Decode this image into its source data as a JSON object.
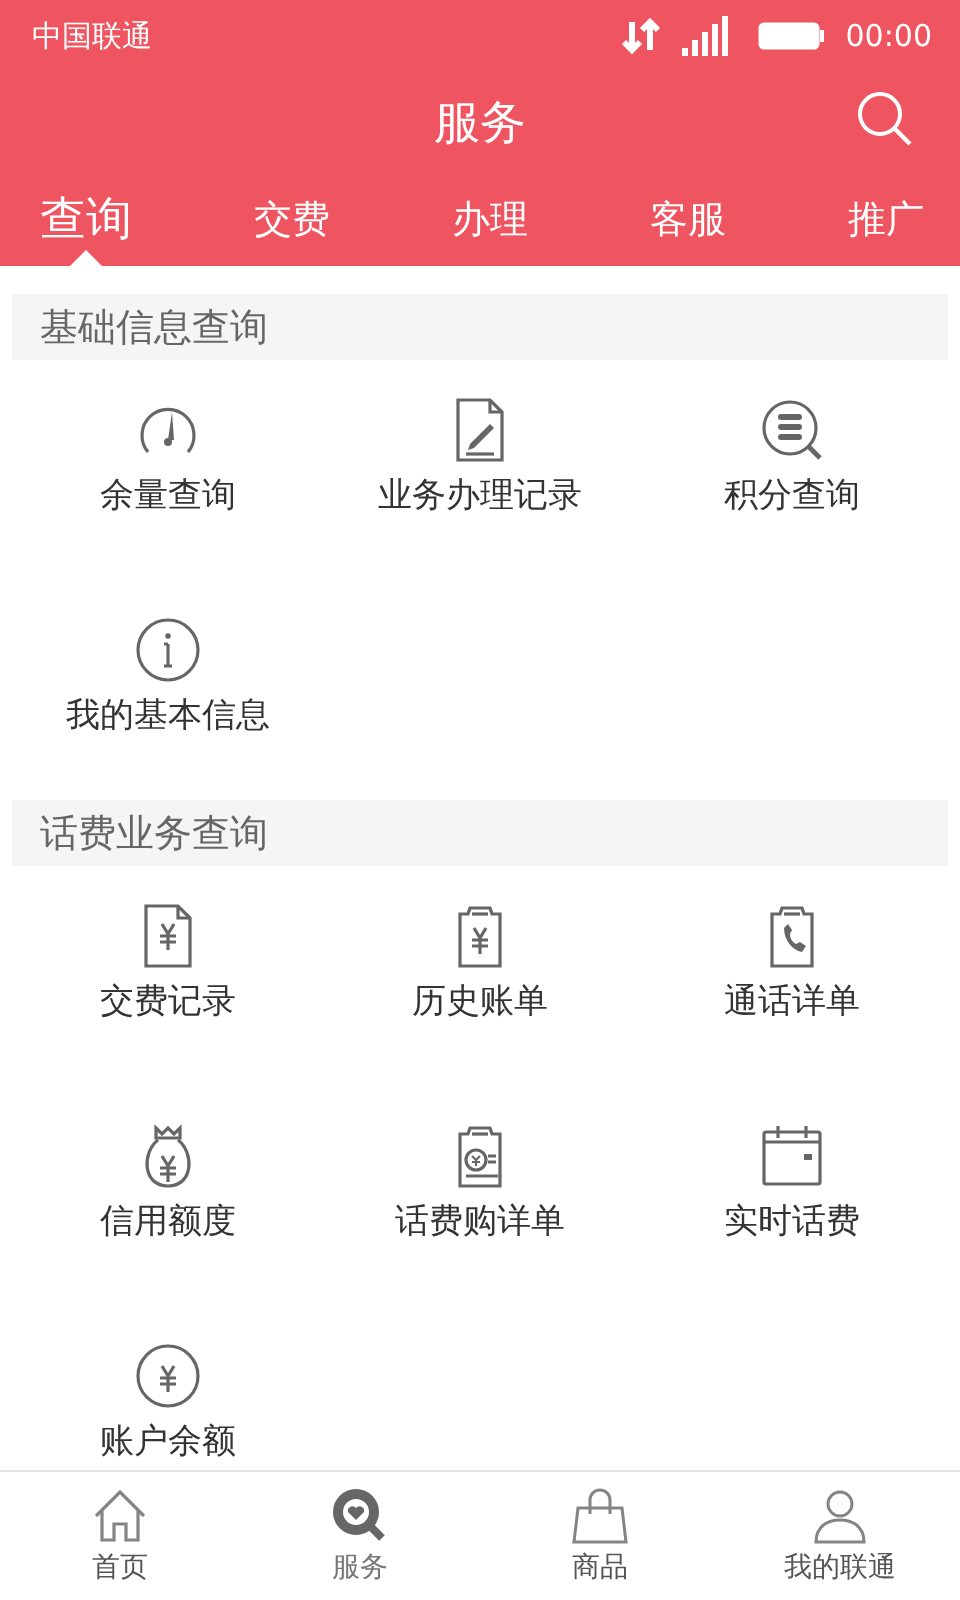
{
  "status_bar": {
    "carrier": "中国联通",
    "time": "00:00"
  },
  "title": "服务",
  "tabs": [
    {
      "label": "查询",
      "selected": true
    },
    {
      "label": "交费",
      "selected": false
    },
    {
      "label": "办理",
      "selected": false
    },
    {
      "label": "客服",
      "selected": false
    },
    {
      "label": "推广",
      "selected": false
    }
  ],
  "sections": [
    {
      "title": "基础信息查询",
      "items": [
        {
          "label": "余量查询",
          "kind": "gauge"
        },
        {
          "label": "业务办理记录",
          "kind": "record"
        },
        {
          "label": "积分查询",
          "kind": "points"
        },
        {
          "label": "我的基本信息",
          "kind": "info"
        }
      ]
    },
    {
      "title": "话费业务查询",
      "items": [
        {
          "label": "交费记录",
          "kind": "payment"
        },
        {
          "label": "历史账单",
          "kind": "bill"
        },
        {
          "label": "通话详单",
          "kind": "calls"
        },
        {
          "label": "信用额度",
          "kind": "credit"
        },
        {
          "label": "话费购详单",
          "kind": "purchase"
        },
        {
          "label": "实时话费",
          "kind": "realtime"
        },
        {
          "label": "账户余额",
          "kind": "balance"
        }
      ]
    }
  ],
  "bottom_nav": [
    {
      "label": "首页",
      "kind": "home",
      "selected": false
    },
    {
      "label": "服务",
      "kind": "service",
      "selected": true
    },
    {
      "label": "商品",
      "kind": "shop",
      "selected": false
    },
    {
      "label": "我的联通",
      "kind": "account",
      "selected": false
    }
  ]
}
